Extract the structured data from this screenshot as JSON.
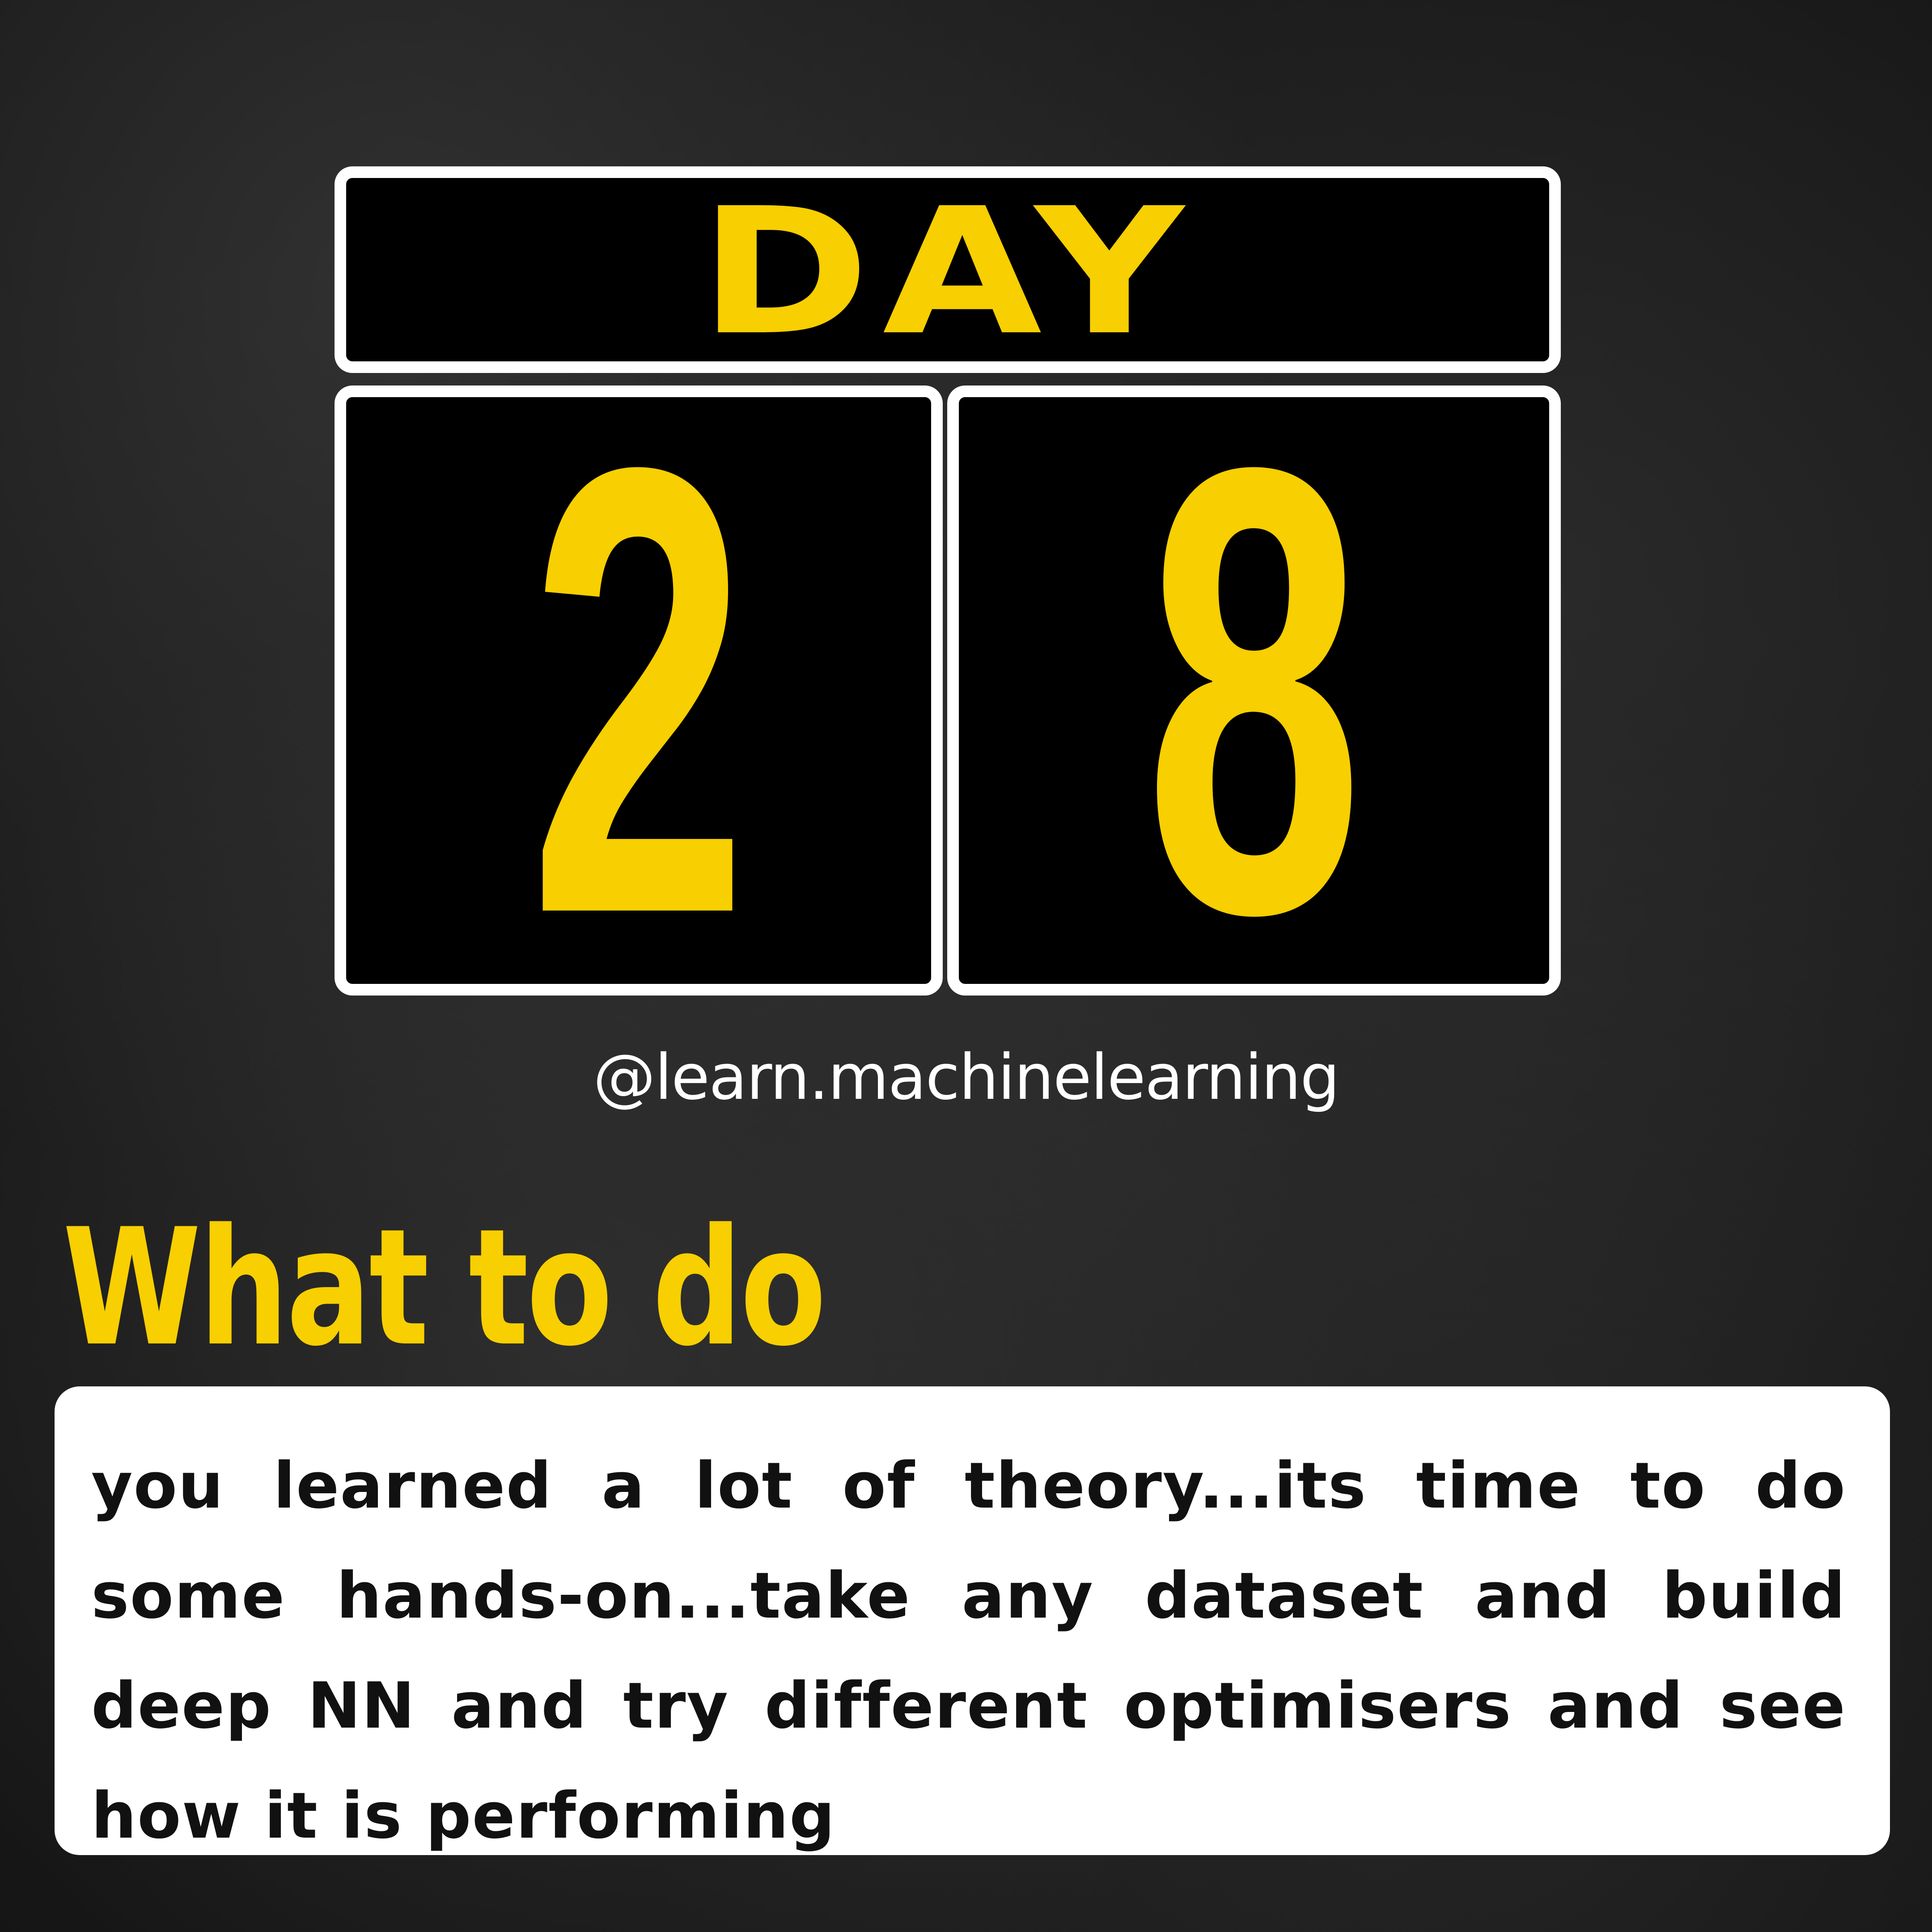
{
  "calendar": {
    "label": "DAY",
    "digits": [
      "2",
      "8"
    ]
  },
  "handle": "@learn.machinelearning",
  "section": {
    "heading": "What to do",
    "body": "you learned a lot of theory...its time to do some hands-on...take any dataset and build deep NN and try different optimisers and see how it is performing"
  },
  "colors": {
    "accent": "#f8cf00",
    "card_background": "#000000",
    "card_border": "#ffffff",
    "page_background": "#262626",
    "body_text": "#111111"
  }
}
